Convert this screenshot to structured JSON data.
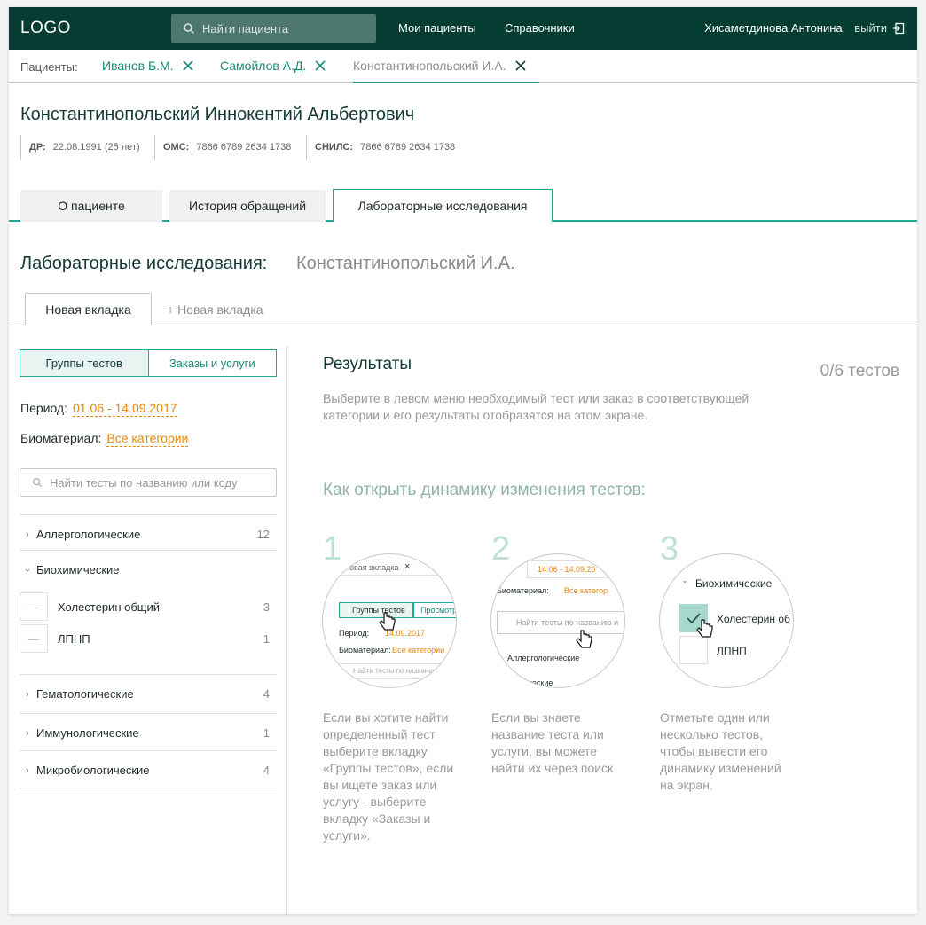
{
  "header": {
    "logo": "LOGO",
    "search_placeholder": "Найти пациента",
    "nav": [
      "Мои пациенты",
      "Справочники"
    ],
    "user_name": "Хисаметдинова Антонина,",
    "logout": "выйти"
  },
  "patient_tabs": {
    "label": "Пациенты:",
    "tabs": [
      "Иванов Б.М.",
      "Самойлов А.Д.",
      "Константинопольский И.А."
    ]
  },
  "patient": {
    "full_name": "Константинопольский Иннокентий Альбертович",
    "dob_label": "ДР:",
    "dob": "22.08.1991 (25 лет)",
    "oms_label": "ОМС:",
    "oms": "7866 6789 2634 1738",
    "snils_label": "СНИЛС:",
    "snils": "7866 6789 2634 1738"
  },
  "main_tabs": [
    "О пациенте",
    "История обращений",
    "Лабораторные исследования"
  ],
  "section": {
    "title": "Лабораторные исследования:",
    "subtitle": "Константинопольский И.А."
  },
  "sub_tabs": {
    "active": "Новая вкладка",
    "add": "+ Новая вкладка"
  },
  "left": {
    "toggle": [
      "Группы тестов",
      "Заказы и услуги"
    ],
    "period_label": "Период:",
    "period_value": "01.06 - 14.09.2017",
    "bio_label": "Биоматериал:",
    "bio_value": "Все категории",
    "search_placeholder": "Найти тесты по названию или коду",
    "categories": [
      {
        "name": "Аллергологические",
        "count": "12"
      },
      {
        "name": "Биохимические",
        "count": ""
      },
      {
        "name": "Гематологические",
        "count": "4"
      },
      {
        "name": "Иммунологические",
        "count": "1"
      },
      {
        "name": "Микробиологические",
        "count": "4"
      }
    ],
    "items": [
      {
        "name": "Холестерин общий",
        "count": "3"
      },
      {
        "name": "ЛПНП",
        "count": "1"
      }
    ]
  },
  "right": {
    "title": "Результаты",
    "count": "0/6 тестов",
    "description": "Выберите в левом меню необходимый тест или заказ в соответствующей категории и его результаты отобразятся на этом экране.",
    "howto": "Как открыть динамику изменения тестов:",
    "steps": [
      {
        "num": "1",
        "text": "Если вы хотите найти определенный тест выберите вкладку «Группы тестов», если вы ищете заказ или услугу - выберите вкладку «Заказы и услуги»."
      },
      {
        "num": "2",
        "text": "Если вы знаете название теста или услуги, вы можете найти их через поиск"
      },
      {
        "num": "3",
        "text": "Отметьте один или несколько тестов, чтобы вывести его динамику изменений на экран."
      }
    ],
    "illustrations": {
      "c1": {
        "tab": "овая вкладка",
        "btn1": "Группы тестов",
        "btn2": "Просмотр",
        "period": "Период:",
        "period_val": "14.09.2017",
        "bio": "Биоматериал:",
        "bio_val": "Все категории",
        "search": "Найти тесты по названию"
      },
      "c2": {
        "date": "14.06 - 14.09.20",
        "bio": "Биоматериал:",
        "bio_val": "Все категор",
        "search": "Найти тесты по названию и",
        "cat1": "Аллергологические",
        "cat2": "мические"
      },
      "c3": {
        "cat": "Биохимические",
        "item1": "Холестерин об",
        "item2": "ЛПНП"
      }
    }
  },
  "colors": {
    "header_bg": "#063d33",
    "accent": "#1ea891",
    "link": "#178a78",
    "orange": "#e7890b"
  }
}
